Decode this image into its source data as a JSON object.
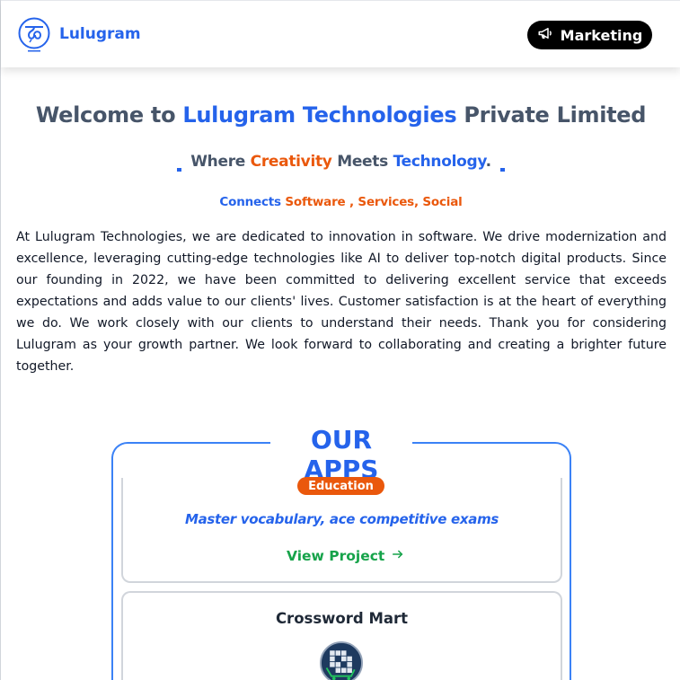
{
  "header": {
    "brand": "Lulugram",
    "logo_icon": "lulugram-logo-icon",
    "marketing_label": "Marketing",
    "marketing_icon": "megaphone-icon"
  },
  "hero": {
    "welcome_prefix": "Welcome to ",
    "welcome_company": "Lulugram Technologies",
    "welcome_suffix": " Private Limited",
    "tagline_where": "Where ",
    "tagline_creativity": "Creativity",
    "tagline_meets": " Meets ",
    "tagline_technology": "Technology",
    "tagline_period": ".",
    "connects_label": "Connects ",
    "connects_items": "Software , Services, Social"
  },
  "about": {
    "text": "At Lulugram Technologies, we are dedicated to innovation in software. We drive modernization and excellence, leveraging cutting-edge technologies like AI to deliver top-notch digital products. Since our founding in 2022, we have been committed to delivering excellent service that exceeds expectations and adds value to our clients' lives. Customer satisfaction is at the heart of everything we do. We work closely with our clients to understand their needs. Thank you for considering Lulugram as your growth partner. We look forward to collaborating and creating a brighter future together."
  },
  "apps": {
    "title": "OUR APPS",
    "cards": [
      {
        "badge": "Education",
        "description": "Master vocabulary, ace competitive exams",
        "link_label": "View Project",
        "link_icon": "arrow-right-icon"
      },
      {
        "title": "Crossword Mart",
        "icon": "crossword-app-icon"
      }
    ]
  },
  "colors": {
    "accent_blue": "#2563eb",
    "accent_orange": "#ea580c",
    "link_green": "#16a34a",
    "heading_gray": "#475569"
  }
}
